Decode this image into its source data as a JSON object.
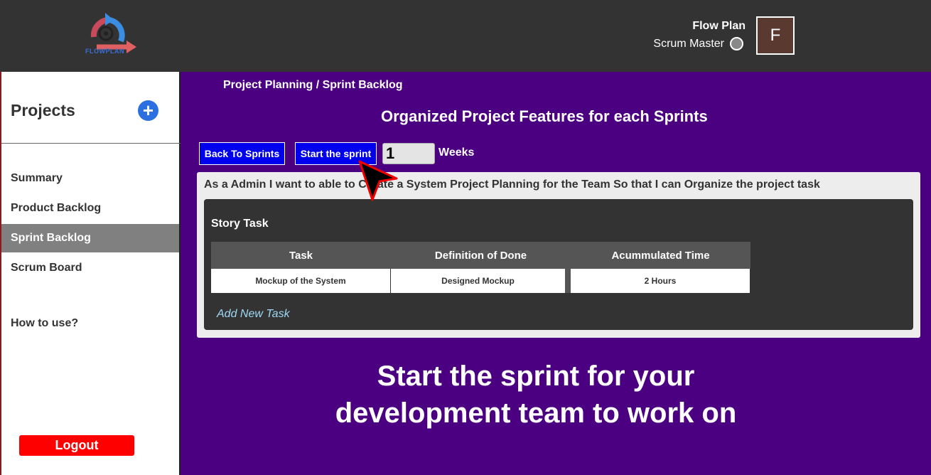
{
  "app": {
    "logo_text": "FLOWPLAN",
    "brand_colors": {
      "topbar": "#333333",
      "main": "#4b0082",
      "primary_button": "#0000ee",
      "logout": "#ff0000"
    }
  },
  "header": {
    "user_name": "Flow Plan",
    "user_role": "Scrum Master",
    "avatar_letter": "F"
  },
  "sidebar": {
    "title": "Projects",
    "add_icon": "plus-circle-icon",
    "items": [
      {
        "label": "Summary",
        "active": false
      },
      {
        "label": "Product Backlog",
        "active": false
      },
      {
        "label": "Sprint Backlog",
        "active": true
      },
      {
        "label": "Scrum Board",
        "active": false
      }
    ],
    "help_label": "How to use?",
    "logout_label": "Logout"
  },
  "main": {
    "breadcrumb": "Project Planning / Sprint Backlog",
    "title": "Organized Project Features for each Sprints",
    "back_button": "Back To Sprints",
    "start_button": "Start the sprint",
    "weeks_value": "1",
    "weeks_label": "Weeks",
    "story": "As a Admin I want to able to Create a System Project Planning for the Team So that I can Organize the project task",
    "task_panel_title": "Story Task",
    "table": {
      "headers": [
        "Task",
        "Definition of Done",
        "Acummulated Time"
      ],
      "rows": [
        [
          "Mockup of the System",
          "Designed Mockup",
          "2 Hours"
        ]
      ]
    },
    "add_task_label": "Add New Task"
  },
  "caption": {
    "line1": "Start the sprint for your",
    "line2": "development team to work on"
  }
}
